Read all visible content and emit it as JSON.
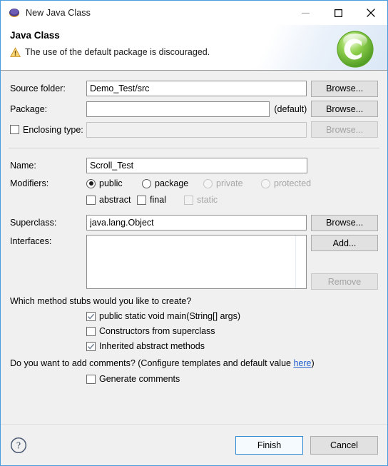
{
  "window": {
    "title": "New Java Class",
    "icon": "eclipse-icon",
    "controls": {
      "minimize": "minimize-icon",
      "maximize": "maximize-icon",
      "close": "close-icon"
    }
  },
  "header": {
    "title": "Java Class",
    "message": "The use of the default package is discouraged.",
    "message_icon": "warning-icon",
    "logo": "green-c-logo",
    "warning_color": "#f0b429"
  },
  "form": {
    "source_folder": {
      "label": "Source folder:",
      "value": "Demo_Test/src",
      "placeholder": "",
      "browse_label": "Browse..."
    },
    "package": {
      "label": "Package:",
      "value": "",
      "placeholder": "",
      "suffix": "(default)",
      "browse_label": "Browse..."
    },
    "enclosing_type": {
      "label": "Enclosing type:",
      "checked": false,
      "value": "",
      "placeholder": "",
      "browse_label": "Browse...",
      "enabled": false
    },
    "name": {
      "label": "Name:",
      "value": "Scroll_Test",
      "placeholder": ""
    },
    "modifiers": {
      "label": "Modifiers:",
      "radios": [
        {
          "label": "public",
          "selected": true,
          "enabled": true
        },
        {
          "label": "package",
          "selected": false,
          "enabled": true
        },
        {
          "label": "private",
          "selected": false,
          "enabled": false
        },
        {
          "label": "protected",
          "selected": false,
          "enabled": false
        }
      ],
      "checkboxes": [
        {
          "label": "abstract",
          "checked": false,
          "enabled": true
        },
        {
          "label": "final",
          "checked": false,
          "enabled": true
        },
        {
          "label": "static",
          "checked": false,
          "enabled": false
        }
      ]
    },
    "superclass": {
      "label": "Superclass:",
      "value": "java.lang.Object",
      "placeholder": "",
      "browse_label": "Browse..."
    },
    "interfaces": {
      "label": "Interfaces:",
      "items": [],
      "add_label": "Add...",
      "remove_label": "Remove",
      "remove_enabled": false
    }
  },
  "stubs": {
    "question": "Which method stubs would you like to create?",
    "options": [
      {
        "label": "public static void main(String[] args)",
        "checked": true
      },
      {
        "label": "Constructors from superclass",
        "checked": false
      },
      {
        "label": "Inherited abstract methods",
        "checked": true
      }
    ]
  },
  "comments": {
    "question_prefix": "Do you want to add comments? (Configure templates and default value ",
    "link_text": "here",
    "question_suffix": ")",
    "option": {
      "label": "Generate comments",
      "checked": false
    },
    "link_color": "#1f5fcf"
  },
  "footer": {
    "help_icon": "help-icon",
    "finish_label": "Finish",
    "cancel_label": "Cancel",
    "default_button_color": "#2f8ad4"
  }
}
